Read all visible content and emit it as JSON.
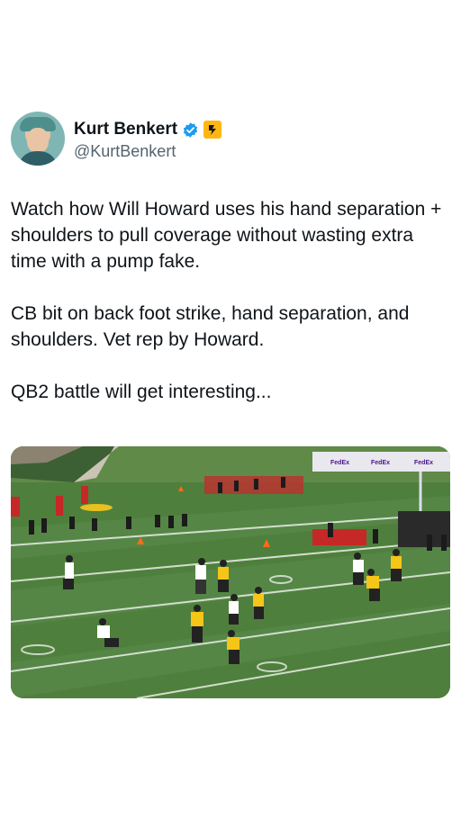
{
  "author": {
    "display_name": "Kurt Benkert",
    "handle": "@KurtBenkert",
    "verified_icon": "verified-badge-icon",
    "team_icon": "team-logo-icon",
    "colors": {
      "verified": "#1d9bf0",
      "team": "#ffb612",
      "handle": "#536471"
    }
  },
  "tweet": {
    "paragraph_1": "Watch how Will Howard uses his hand separation + shoulders to pull coverage without wasting extra time with a pump fake.",
    "paragraph_2": "CB bit on back foot strike, hand separation, and shoulders. Vet rep by Howard.",
    "paragraph_3": "QB2 battle will get interesting..."
  },
  "media": {
    "description_icon": "practice-field-photo",
    "banner_text": "FedEx"
  }
}
